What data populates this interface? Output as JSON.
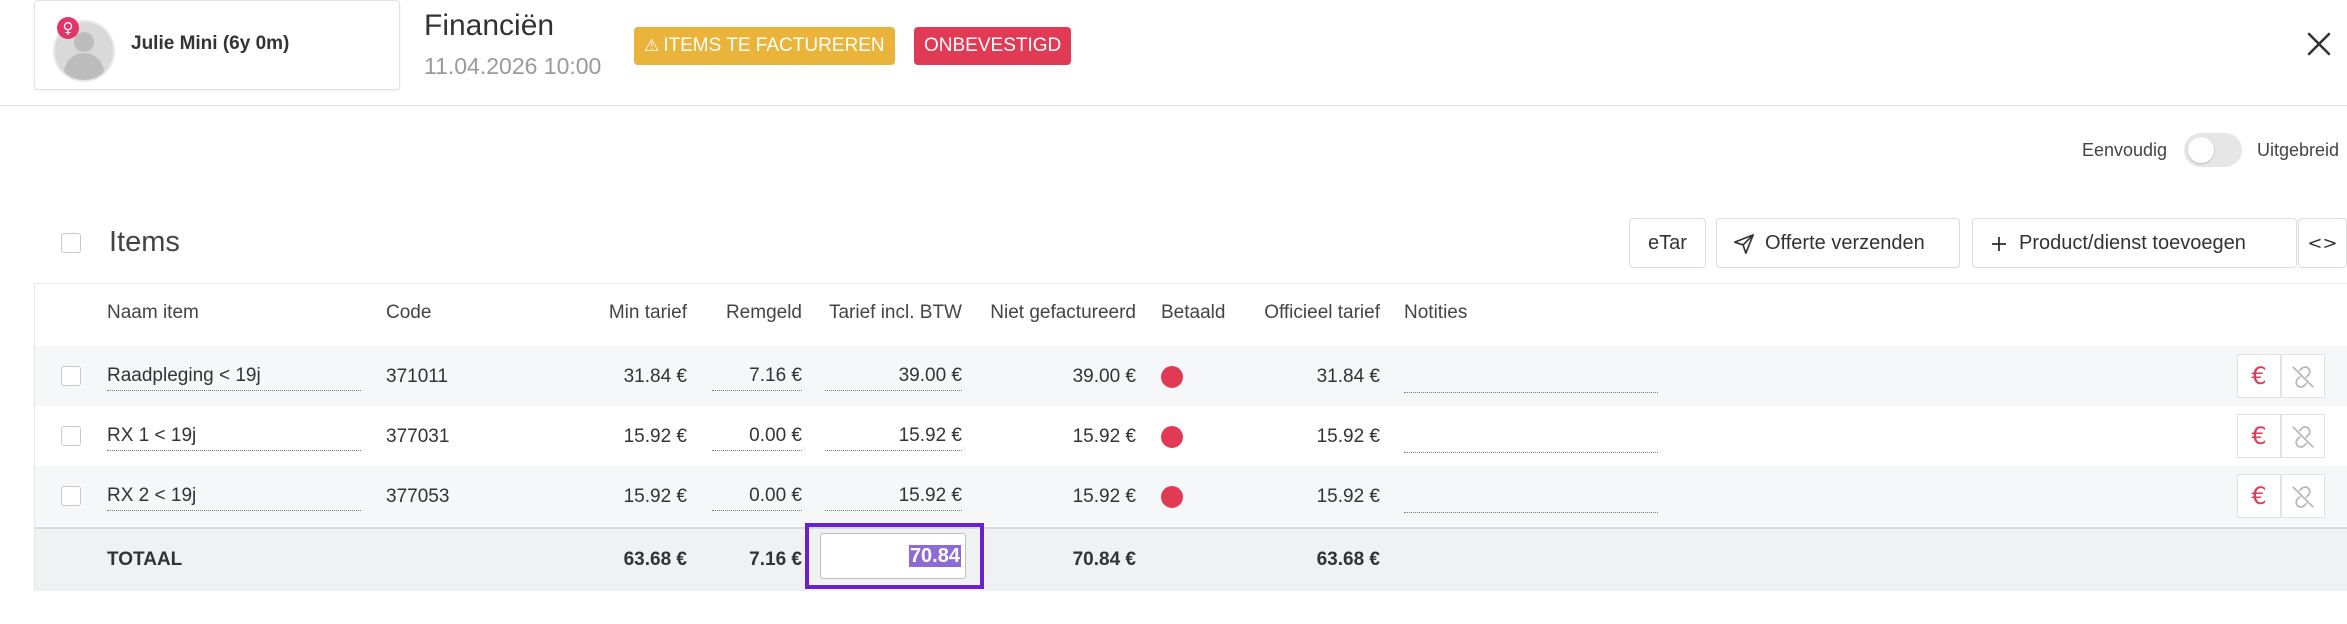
{
  "header": {
    "patient": {
      "name": "Julie Mini (6y 0m)",
      "gender_symbol": "♀"
    },
    "title": "Financiën",
    "datetime": "11.04.2026 10:00",
    "badges": [
      {
        "label": "ITEMS TE FACTUREREN",
        "color": "#eab33a",
        "icon": "warning-icon"
      },
      {
        "label": "ONBEVESTIGD",
        "color": "#e03a55"
      }
    ],
    "close_icon": "close-icon"
  },
  "view_toggle": {
    "left_label": "Eenvoudig",
    "right_label": "Uitgebreid",
    "state": "Eenvoudig"
  },
  "items": {
    "title": "Items",
    "buttons": {
      "etar": "eTar",
      "send_quote": "Offerte verzenden",
      "add_product": "Product/dienst toevoegen",
      "code_icon": "<>"
    },
    "columns": [
      "Naam item",
      "Code",
      "Min tarief",
      "Remgeld",
      "Tarief incl. BTW",
      "Niet gefactureerd",
      "Betaald",
      "Officieel tarief",
      "Notities"
    ],
    "rows": [
      {
        "name": "Raadpleging < 19j",
        "code": "371011",
        "min_tarief": "31.84 €",
        "remgeld": "7.16 €",
        "tarief": "39.00 €",
        "niet_gefactureerd": "39.00 €",
        "betaald": "unpaid",
        "officieel": "31.84 €",
        "notities": ""
      },
      {
        "name": "RX 1 < 19j",
        "code": "377031",
        "min_tarief": "15.92 €",
        "remgeld": "0.00 €",
        "tarief": "15.92 €",
        "niet_gefactureerd": "15.92 €",
        "betaald": "unpaid",
        "officieel": "15.92 €",
        "notities": ""
      },
      {
        "name": "RX 2 < 19j",
        "code": "377053",
        "min_tarief": "15.92 €",
        "remgeld": "0.00 €",
        "tarief": "15.92 €",
        "niet_gefactureerd": "15.92 €",
        "betaald": "unpaid",
        "officieel": "15.92 €",
        "notities": ""
      }
    ],
    "total": {
      "label": "TOTAAL",
      "min_tarief": "63.68 €",
      "remgeld": "7.16 €",
      "tarief_input": "70.84",
      "niet_gefactureerd": "70.84 €",
      "officieel": "63.68 €"
    },
    "row_actions": {
      "euro": "€"
    },
    "status_color": "#e03a55"
  }
}
